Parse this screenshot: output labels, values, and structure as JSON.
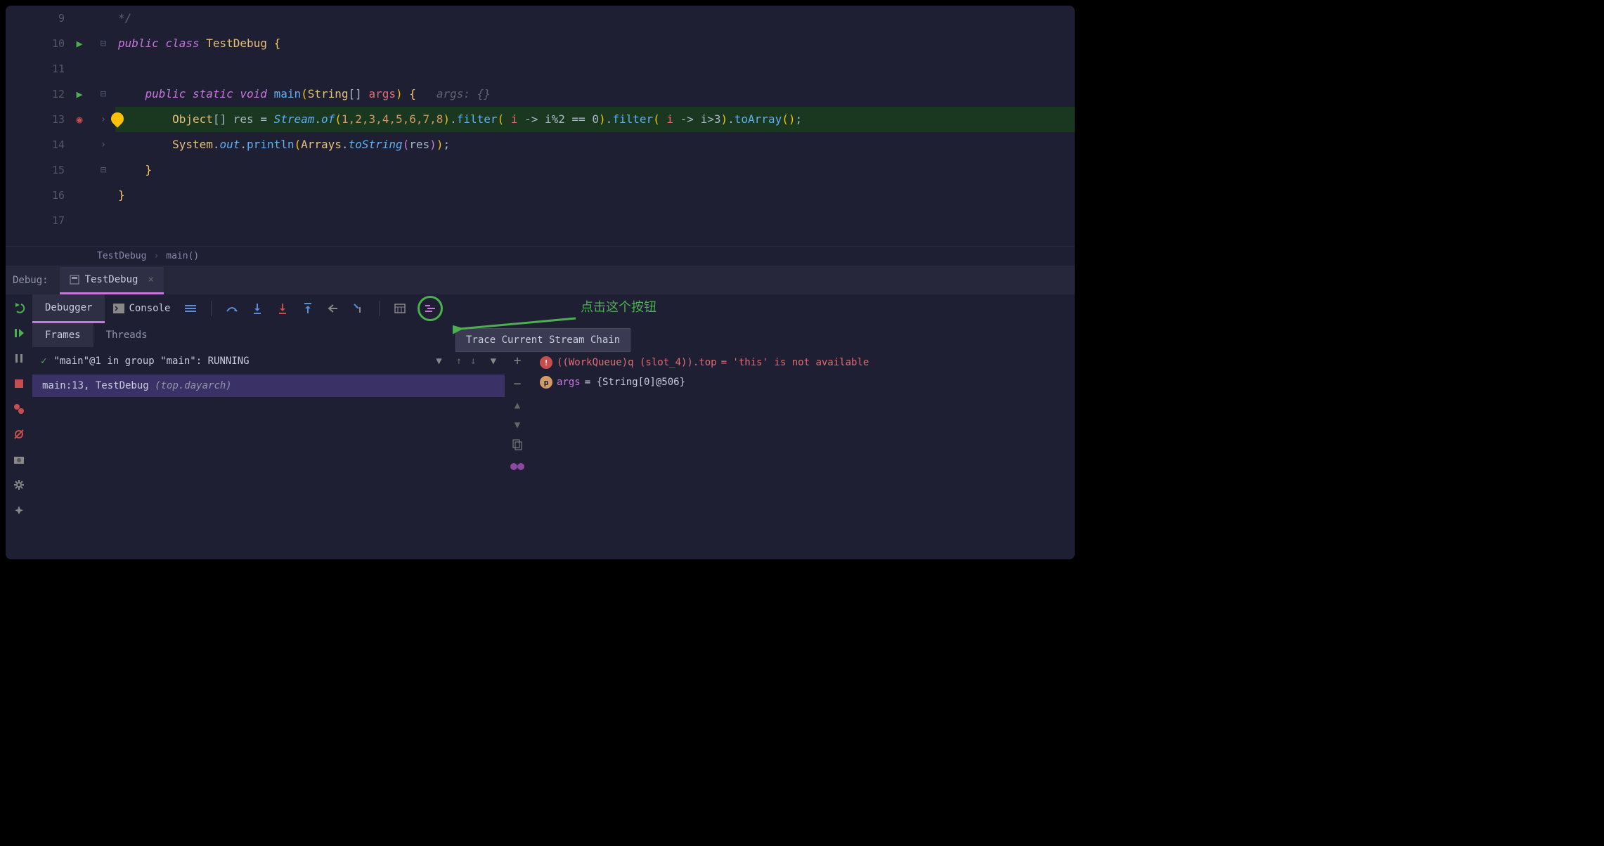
{
  "editor": {
    "lines": [
      {
        "num": "9"
      },
      {
        "num": "10",
        "run": true
      },
      {
        "num": "11"
      },
      {
        "num": "12",
        "run": true
      },
      {
        "num": "13",
        "breakpoint": true,
        "highlighted": true,
        "bulb": true
      },
      {
        "num": "14"
      },
      {
        "num": "15"
      },
      {
        "num": "16"
      },
      {
        "num": "17"
      }
    ],
    "code": {
      "l10_public": "public",
      "l10_class": "class",
      "l10_name": "TestDebug",
      "l10_brace": "{",
      "l12_public": "public",
      "l12_static": "static",
      "l12_void": "void",
      "l12_main": "main",
      "l12_string": "String",
      "l12_args": "args",
      "l12_hint": "args: {}",
      "l13_object": "Object",
      "l13_res": "res",
      "l13_stream": "Stream",
      "l13_of": "of",
      "l13_nums": "1,2,3,4,5,6,7,8",
      "l13_filter": "filter",
      "l13_i": "i",
      "l13_arrow": "->",
      "l13_mod": "i%2 == 0",
      "l13_gt": "i>3",
      "l13_toarray": "toArray",
      "l14_system": "System",
      "l14_out": "out",
      "l14_println": "println",
      "l14_arrays": "Arrays",
      "l14_tostring": "toString",
      "l14_res": "res",
      "l15_brace": "}",
      "l16_brace": "}"
    }
  },
  "breadcrumb": {
    "items": [
      "TestDebug",
      "main()"
    ]
  },
  "debug": {
    "label": "Debug:",
    "tab_name": "TestDebug",
    "debugger_tab": "Debugger",
    "console_tab": "Console",
    "frames_tab": "Frames",
    "threads_tab": "Threads",
    "tooltip": "Trace Current Stream Chain",
    "frame_header": "\"main\"@1 in group \"main\": RUNNING",
    "frame_row_main": "main:13, TestDebug",
    "frame_row_pkg": "(top.dayarch)"
  },
  "variables": {
    "err_expr": "((WorkQueue)q (slot_4)).top",
    "err_msg": " = 'this' is not available",
    "args_name": "args",
    "args_val": " = {String[0]@506}",
    "p_badge": "p"
  },
  "annotation": {
    "text": "点击这个按钮"
  }
}
